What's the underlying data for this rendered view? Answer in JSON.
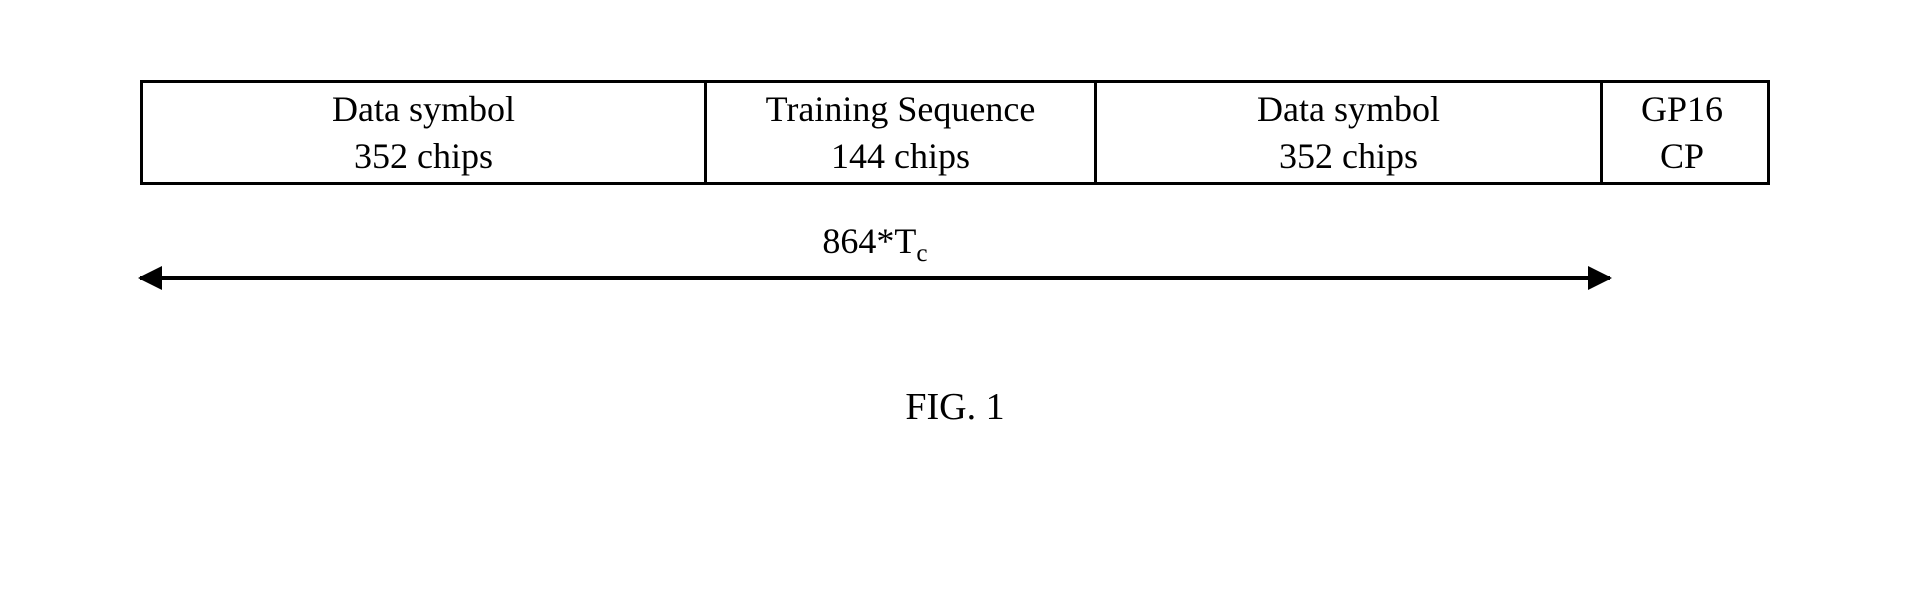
{
  "cells": [
    {
      "line1": "Data symbol",
      "line2": "352 chips"
    },
    {
      "line1": "Training Sequence",
      "line2": "144 chips"
    },
    {
      "line1": "Data symbol",
      "line2": "352 chips"
    },
    {
      "line1": "GP16",
      "line2": "CP"
    }
  ],
  "arrow": {
    "prefix": "864*T",
    "sub": "c"
  },
  "figure": "FIG. 1"
}
